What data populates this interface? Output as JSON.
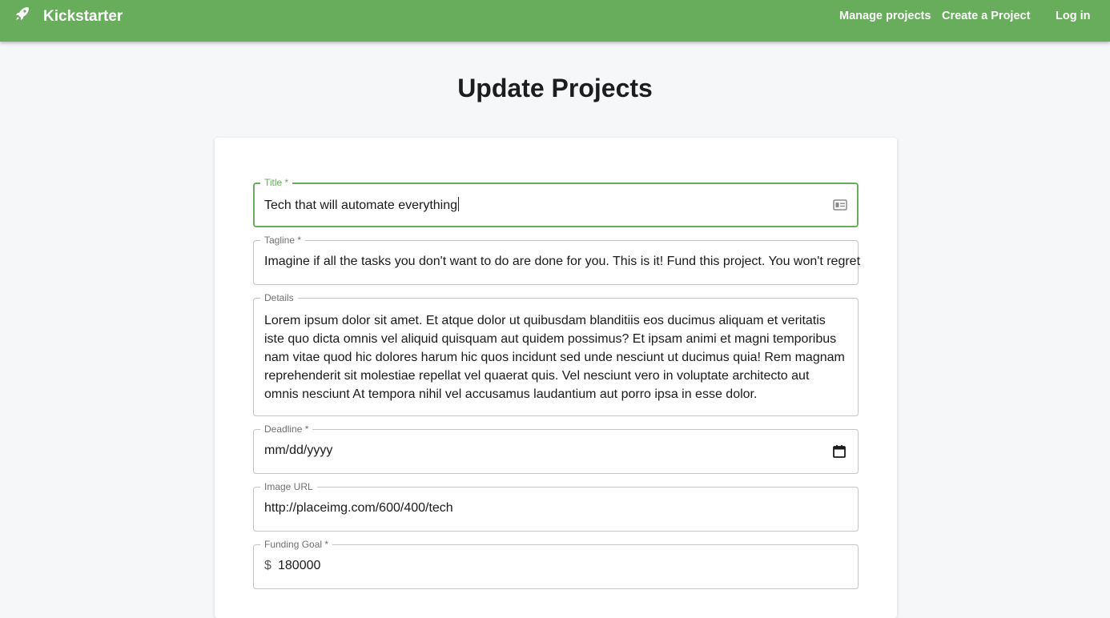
{
  "navbar": {
    "brand": "Kickstarter",
    "brand_icon": "rocket-icon",
    "links": [
      "Manage projects",
      "Create a Project",
      "Log in"
    ],
    "color": "#67ad5b"
  },
  "page": {
    "title": "Update Projects"
  },
  "form": {
    "title": {
      "label": "Title *",
      "value": "Tech that will automate everything",
      "icon": "id-card-icon"
    },
    "tagline": {
      "label": "Tagline *",
      "value": "Imagine if all the tasks you don't want to do are done for you. This is it! Fund this project. You won't regret"
    },
    "details": {
      "label": "Details",
      "value": "Lorem ipsum dolor sit amet. Et atque dolor ut quibusdam blanditiis eos ducimus aliquam et veritatis iste quo dicta omnis vel aliquid quisquam aut quidem possimus? Et ipsam animi et magni temporibus nam vitae quod hic dolores harum hic quos incidunt sed unde nesciunt ut ducimus quia! Rem magnam reprehenderit sit molestiae repellat vel quaerat quis. Vel nesciunt vero in voluptate architecto aut omnis nesciunt At tempora nihil vel accusamus laudantium aut porro ipsa in esse dolor."
    },
    "deadline": {
      "label": "Deadline *",
      "value": "mm/dd/yyyy",
      "icon": "calendar-icon"
    },
    "image_url": {
      "label": "Image URL",
      "value": "http://placeimg.com/600/400/tech"
    },
    "funding_goal": {
      "label": "Funding Goal *",
      "prefix": "$",
      "value": "180000"
    }
  }
}
